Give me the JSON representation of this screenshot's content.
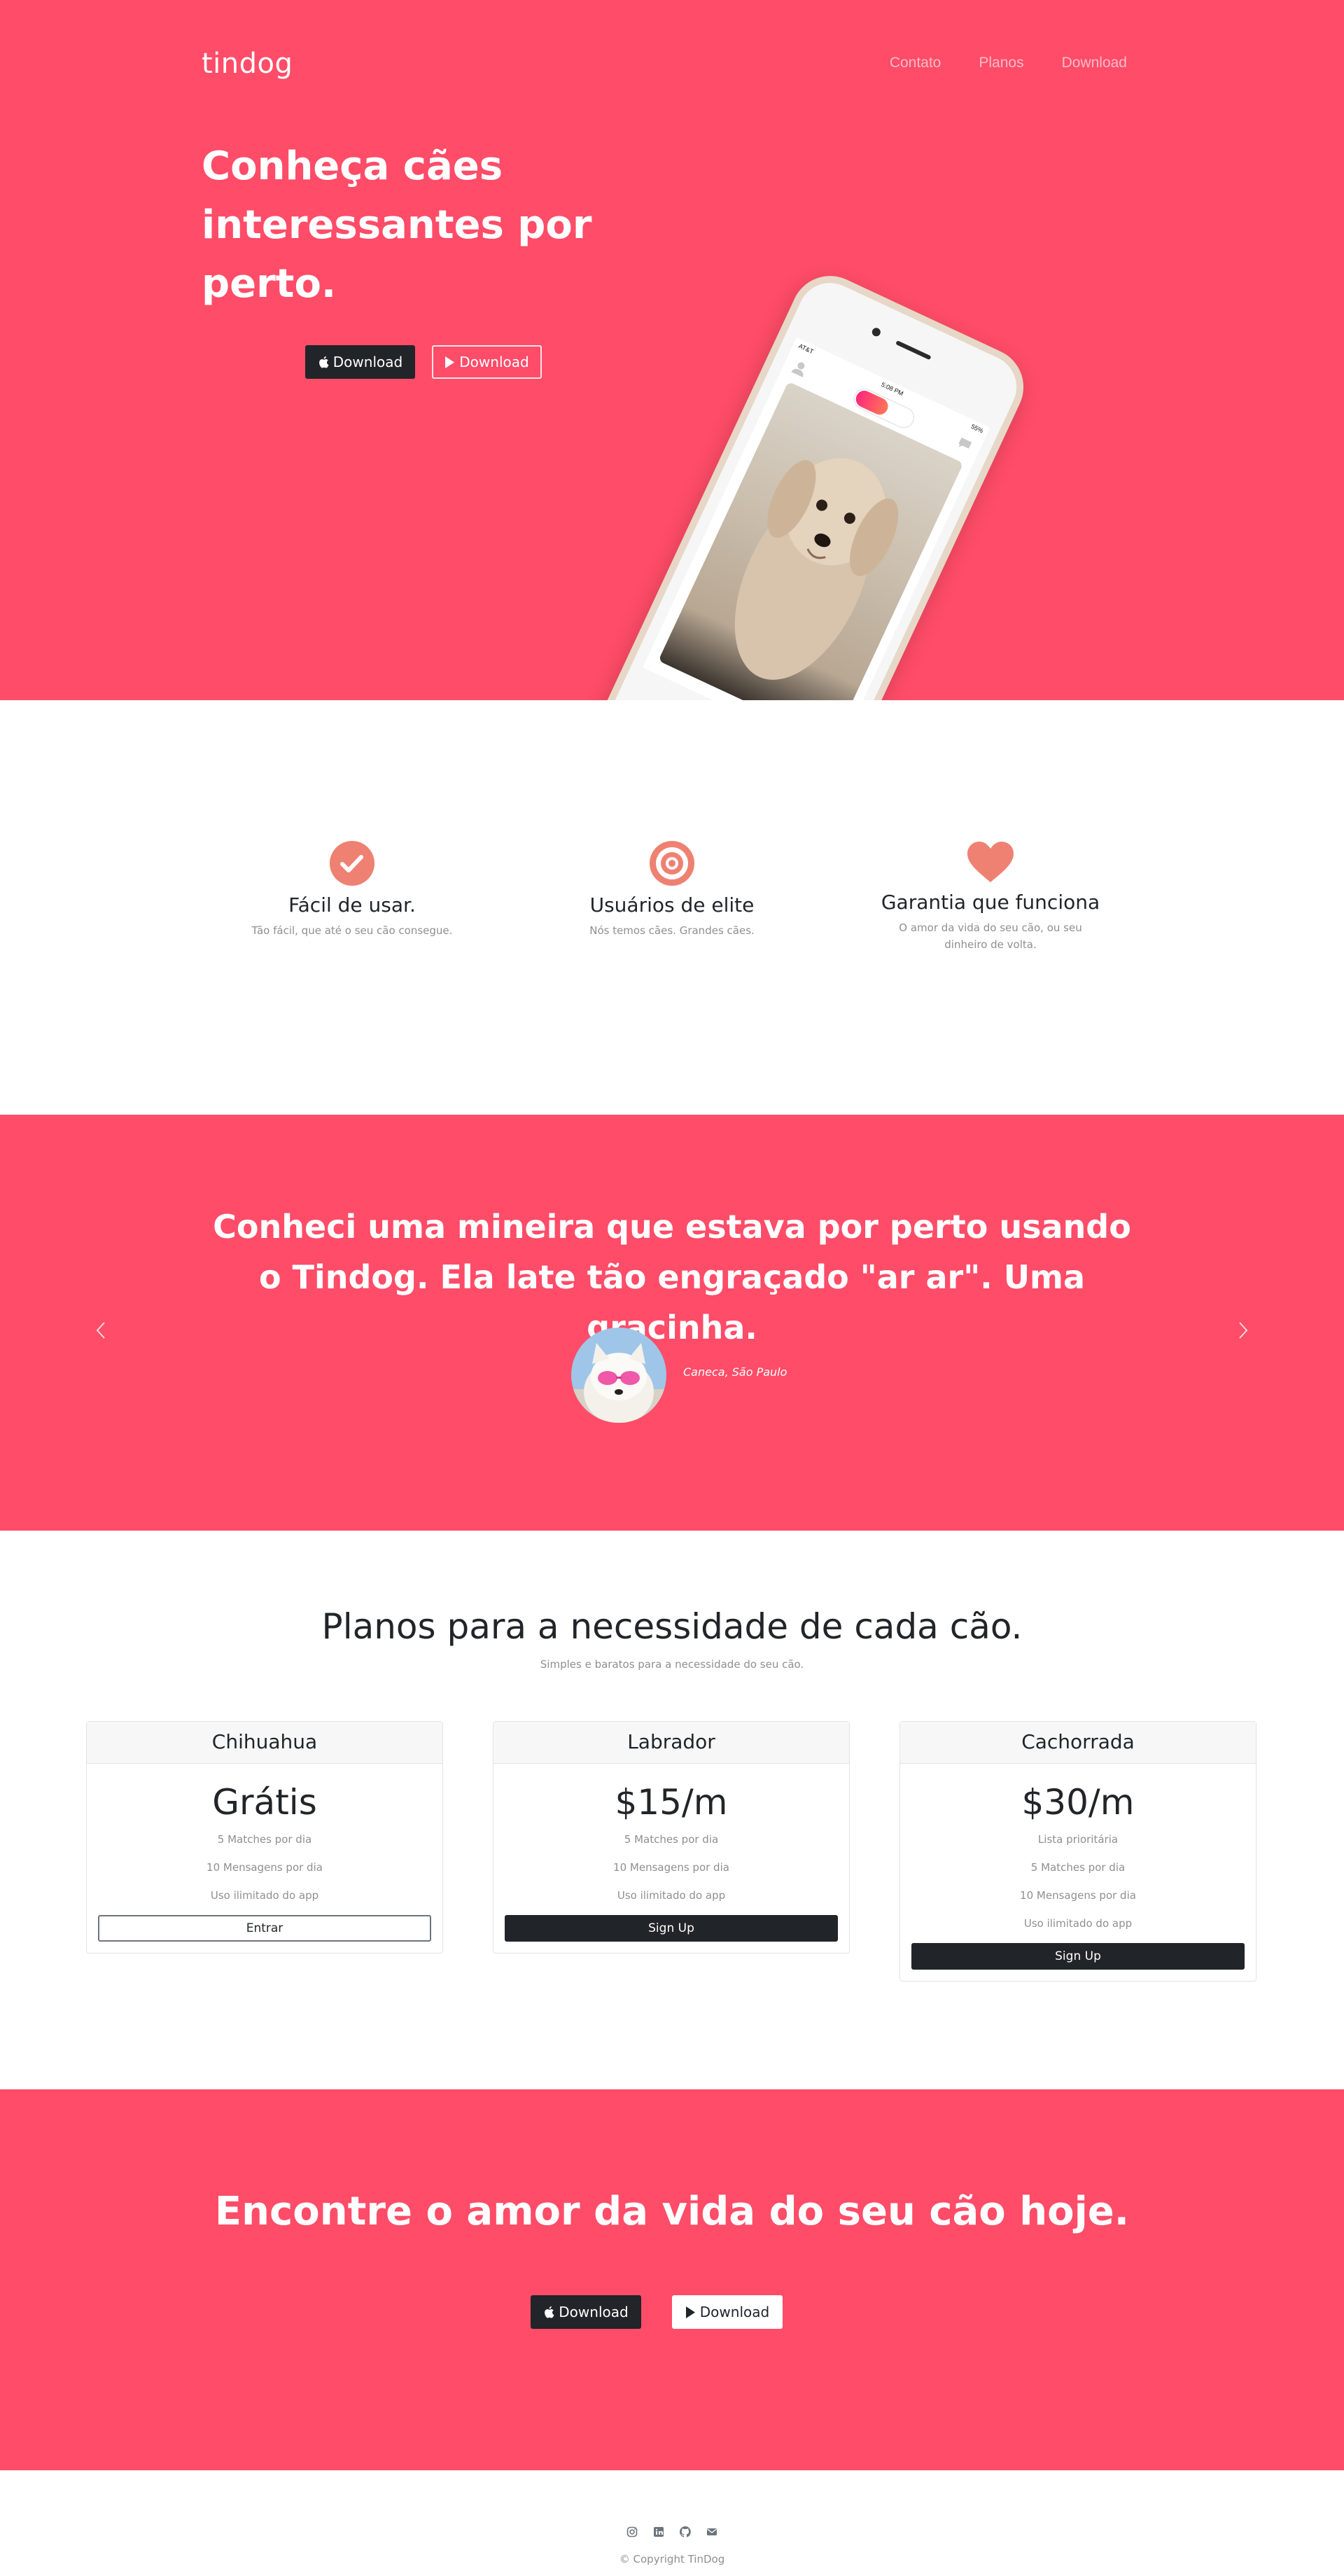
{
  "nav": {
    "brand": "tindog",
    "links": [
      "Contato",
      "Planos",
      "Download"
    ]
  },
  "hero": {
    "title": "Conheça cães interessantes por perto.",
    "buttons": [
      {
        "label": "Download",
        "icon": "apple-icon",
        "style": "dark"
      },
      {
        "label": "Download",
        "icon": "google-play-icon",
        "style": "outline-light"
      }
    ],
    "phone_screen": {
      "carrier": "AT&T",
      "time": "5:08 PM",
      "battery": "55%"
    }
  },
  "features": [
    {
      "icon": "check-circle-icon",
      "title": "Fácil de usar.",
      "text": "Tão fácil, que até o seu cão consegue."
    },
    {
      "icon": "bullseye-icon",
      "title": "Usuários de elite",
      "text": "Nós temos cães. Grandes cães."
    },
    {
      "icon": "heart-icon",
      "title": "Garantia que funciona",
      "text": "O amor da vida do seu cão, ou seu dinheiro de volta."
    }
  ],
  "testimonial": {
    "quote": "Conheci uma mineira que estava por perto usando o Tindog. Ela late tão engraçado \"ar ar\". Uma gracinha.",
    "credit": "Caneca, São Paulo"
  },
  "pricing": {
    "title": "Planos para a necessidade de cada cão.",
    "subtitle": "Simples e baratos para a necessidade do seu cão.",
    "plans": [
      {
        "name": "Chihuahua",
        "price": "Grátis",
        "features": [
          "5 Matches por dia",
          "10 Mensagens por dia",
          "Uso ilimitado do app"
        ],
        "button": "Entrar"
      },
      {
        "name": "Labrador",
        "price": "$15/m",
        "features": [
          "5 Matches por dia",
          "10 Mensagens por dia",
          "Uso ilimitado do app"
        ],
        "button": "Sign Up"
      },
      {
        "name": "Cachorrada",
        "price": "$30/m",
        "features": [
          "Lista prioritária",
          "5 Matches por dia",
          "10 Mensagens por dia",
          "Uso ilimitado do app"
        ],
        "button": "Sign Up"
      }
    ]
  },
  "cta": {
    "title": "Encontre o amor da vida do seu cão hoje.",
    "buttons": [
      {
        "label": "Download",
        "icon": "apple-icon",
        "style": "dark"
      },
      {
        "label": "Download",
        "icon": "google-play-icon",
        "style": "light"
      }
    ]
  },
  "footer": {
    "social_icons": [
      "instagram-icon",
      "linkedin-icon",
      "github-icon",
      "envelope-icon"
    ],
    "copyright": "© Copyright TinDog"
  },
  "colors": {
    "brand_red": "#ff4c68",
    "dark": "#212529",
    "icon_pink": "#ef8172",
    "muted_text": "#8f8f8f"
  }
}
